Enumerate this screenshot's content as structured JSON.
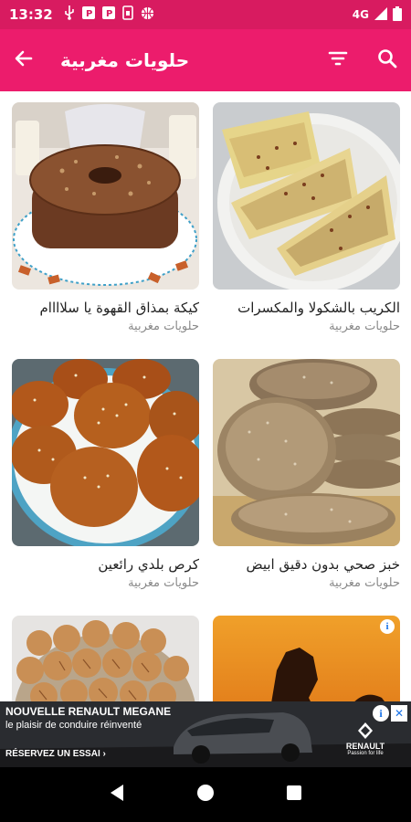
{
  "status_bar": {
    "time": "13:32",
    "left_icons": [
      "usb-icon",
      "p-icon",
      "p-icon",
      "sim-icon",
      "basketball-icon"
    ],
    "network": "4G",
    "right_icons": [
      "network-4g-icon",
      "signal-icon",
      "battery-icon"
    ]
  },
  "appbar": {
    "title": "حلويات مغربية",
    "bg_color": "#ec1c6c"
  },
  "recipes": [
    {
      "title": "الكريب بالشكولا والمكسرات",
      "category": "حلويات مغربية"
    },
    {
      "title": "كيكة بمذاق القهوة يا سلاااام",
      "category": "حلويات مغربية"
    },
    {
      "title": "خبز صحي بدون دقيق ابيض",
      "category": "حلويات مغربية"
    },
    {
      "title": "كرص بلدي رائعين",
      "category": "حلويات مغربية"
    }
  ],
  "ad": {
    "headline": "NOUVELLE RENAULT MEGANE",
    "tagline": "le plaisir de conduire réinventé",
    "cta": "RÉSERVEZ UN ESSAI ›",
    "brand": "RENAULT",
    "brand_tagline": "Passion for life"
  }
}
